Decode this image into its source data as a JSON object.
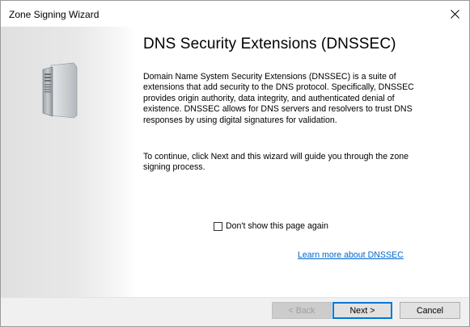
{
  "window": {
    "title": "Zone Signing Wizard",
    "close_icon": "close-icon"
  },
  "banner": {
    "icon": "server-icon"
  },
  "main": {
    "heading": "DNS Security Extensions (DNSSEC)",
    "description": "Domain Name System Security Extensions (DNSSEC) is a suite of extensions that add security to the DNS protocol. Specifically, DNSSEC provides origin authority, data integrity, and authenticated denial of existence. DNSSEC allows for DNS servers and resolvers to trust DNS responses by using digital signatures for validation.",
    "continue_text": "To continue, click Next and this wizard will guide you through the zone signing process.",
    "checkbox_label": "Don't show this page again",
    "checkbox_checked": false,
    "learn_more_link": "Learn more about DNSSEC"
  },
  "footer": {
    "back_label": "< Back",
    "back_enabled": false,
    "next_label": "Next >",
    "cancel_label": "Cancel"
  },
  "colors": {
    "link": "#0066cc",
    "focus_border": "#0078d7",
    "footer_bg": "#f0f0f0"
  }
}
